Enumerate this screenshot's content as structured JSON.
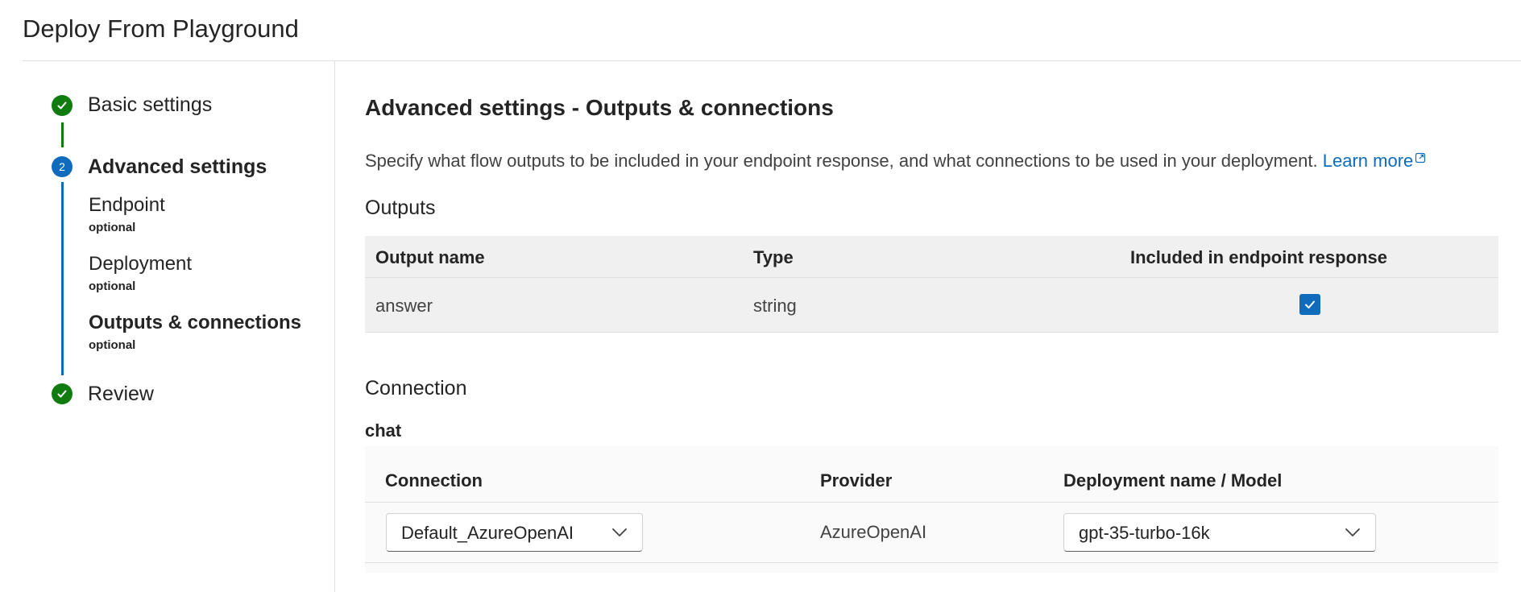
{
  "page": {
    "title": "Deploy From Playground"
  },
  "wizard": {
    "steps": [
      {
        "label": "Basic settings",
        "state": "complete"
      },
      {
        "label": "Advanced settings",
        "state": "current",
        "number": "2",
        "substeps": [
          {
            "label": "Endpoint",
            "note": "optional"
          },
          {
            "label": "Deployment",
            "note": "optional"
          },
          {
            "label": "Outputs & connections",
            "note": "optional",
            "active": true
          }
        ]
      },
      {
        "label": "Review",
        "state": "complete"
      }
    ]
  },
  "main": {
    "heading": "Advanced settings - Outputs & connections",
    "description": "Specify what flow outputs to be included in your endpoint response, and what connections to be used in your deployment.",
    "learn_more": "Learn more",
    "outputs": {
      "heading": "Outputs",
      "columns": [
        "Output name",
        "Type",
        "Included in endpoint response"
      ],
      "rows": [
        {
          "name": "answer",
          "type": "string",
          "included": true
        }
      ]
    },
    "connection": {
      "heading": "Connection",
      "group": "chat",
      "columns": [
        "Connection",
        "Provider",
        "Deployment name / Model"
      ],
      "rows": [
        {
          "connection": "Default_AzureOpenAI",
          "provider": "AzureOpenAI",
          "model": "gpt-35-turbo-16k"
        }
      ]
    }
  },
  "colors": {
    "accent": "#0f6cbd",
    "success": "#107c10"
  },
  "icons": [
    "check-icon",
    "external-link-icon",
    "chevron-down-icon"
  ]
}
